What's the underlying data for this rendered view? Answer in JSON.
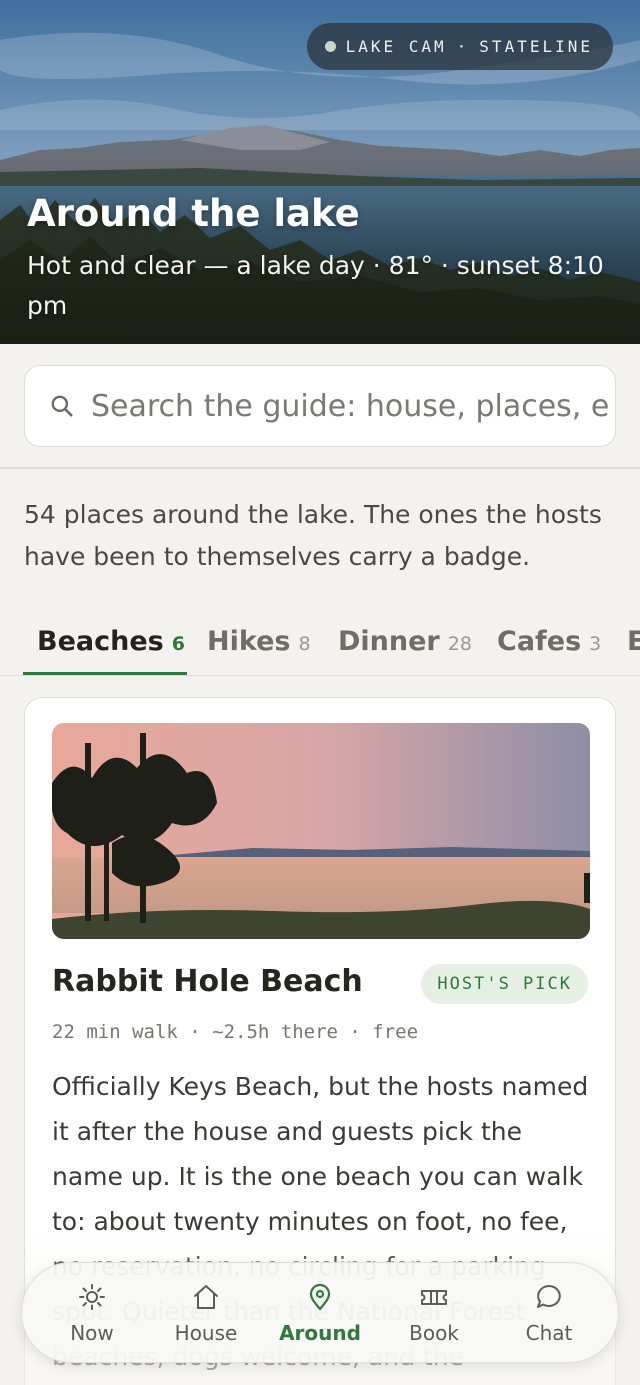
{
  "hero": {
    "cam_label": "LAKE CAM",
    "cam_separator": "·",
    "cam_location": "STATELINE",
    "title": "Around the lake",
    "subtitle": "Hot and clear — a lake day · 81° · sunset 8:10 pm"
  },
  "search": {
    "placeholder": "Search the guide: house, places, e",
    "icon": "search-icon"
  },
  "intro_text": "54 places around the lake. The ones the hosts have been to themselves carry a badge.",
  "tabs": [
    {
      "label": "Beaches",
      "count": "6",
      "active": true
    },
    {
      "label": "Hikes",
      "count": "8",
      "active": false
    },
    {
      "label": "Dinner",
      "count": "28",
      "active": false
    },
    {
      "label": "Cafes",
      "count": "3",
      "active": false
    },
    {
      "label": "E",
      "count": "",
      "active": false
    }
  ],
  "card": {
    "title": "Rabbit Hole Beach",
    "badge": "HOST'S PICK",
    "meta": "22 min walk · ~2.5h there · free",
    "description": "Officially Keys Beach, but the hosts named it after the house and guests pick the name up. It is the one beach you can walk to: about twenty minutes on foot, no fee, no reservation, no circling for a parking spot. Quieter than the National Forest beaches, dogs welcome, and the"
  },
  "bottom_nav": [
    {
      "label": "Now",
      "icon": "sun-icon",
      "active": false
    },
    {
      "label": "House",
      "icon": "house-icon",
      "active": false
    },
    {
      "label": "Around",
      "icon": "map-pin-icon",
      "active": true
    },
    {
      "label": "Book",
      "icon": "ticket-icon",
      "active": false
    },
    {
      "label": "Chat",
      "icon": "chat-bubble-icon",
      "active": false
    }
  ],
  "colors": {
    "accent": "#2f7a3a",
    "background": "#f3f2ee",
    "badge_bg": "#e6efe4"
  }
}
